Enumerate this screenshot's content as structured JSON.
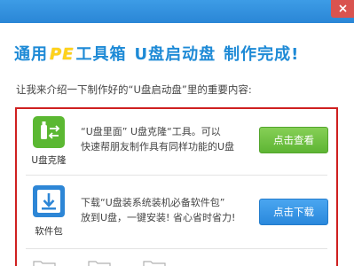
{
  "window": {
    "close_icon": "close-icon"
  },
  "header": {
    "part1": "通用",
    "pe": "PE",
    "part2": "工具箱",
    "part3": "U盘启动盘",
    "part4": "制作完成!"
  },
  "intro": "让我来介绍一下制作好的“U盘启动盘”里的重要内容:",
  "colors": {
    "title_blue": "#1e8ad6",
    "pe_yellow": "#ffd21a",
    "panel_border": "#cf2020",
    "green_button": "#5eb534",
    "blue_button": "#2a88dc"
  },
  "items": [
    {
      "icon": "usb-clone-icon",
      "label": "U盘克隆",
      "desc_line1": "“U盘里面” U盘克隆“工具。可以",
      "desc_line2": "快速帮朋友制作具有同样功能的U盘",
      "button": "点击查看"
    },
    {
      "icon": "download-box-icon",
      "label": "软件包",
      "desc_line1": "下载“U盘装系统装机必备软件包”",
      "desc_line2": "放到U盘，一键安装! 省心省时省力!",
      "button": "点击下载"
    }
  ],
  "partial_row": {
    "icons": [
      "folder-icon",
      "folder-icon",
      "folder-icon"
    ]
  }
}
